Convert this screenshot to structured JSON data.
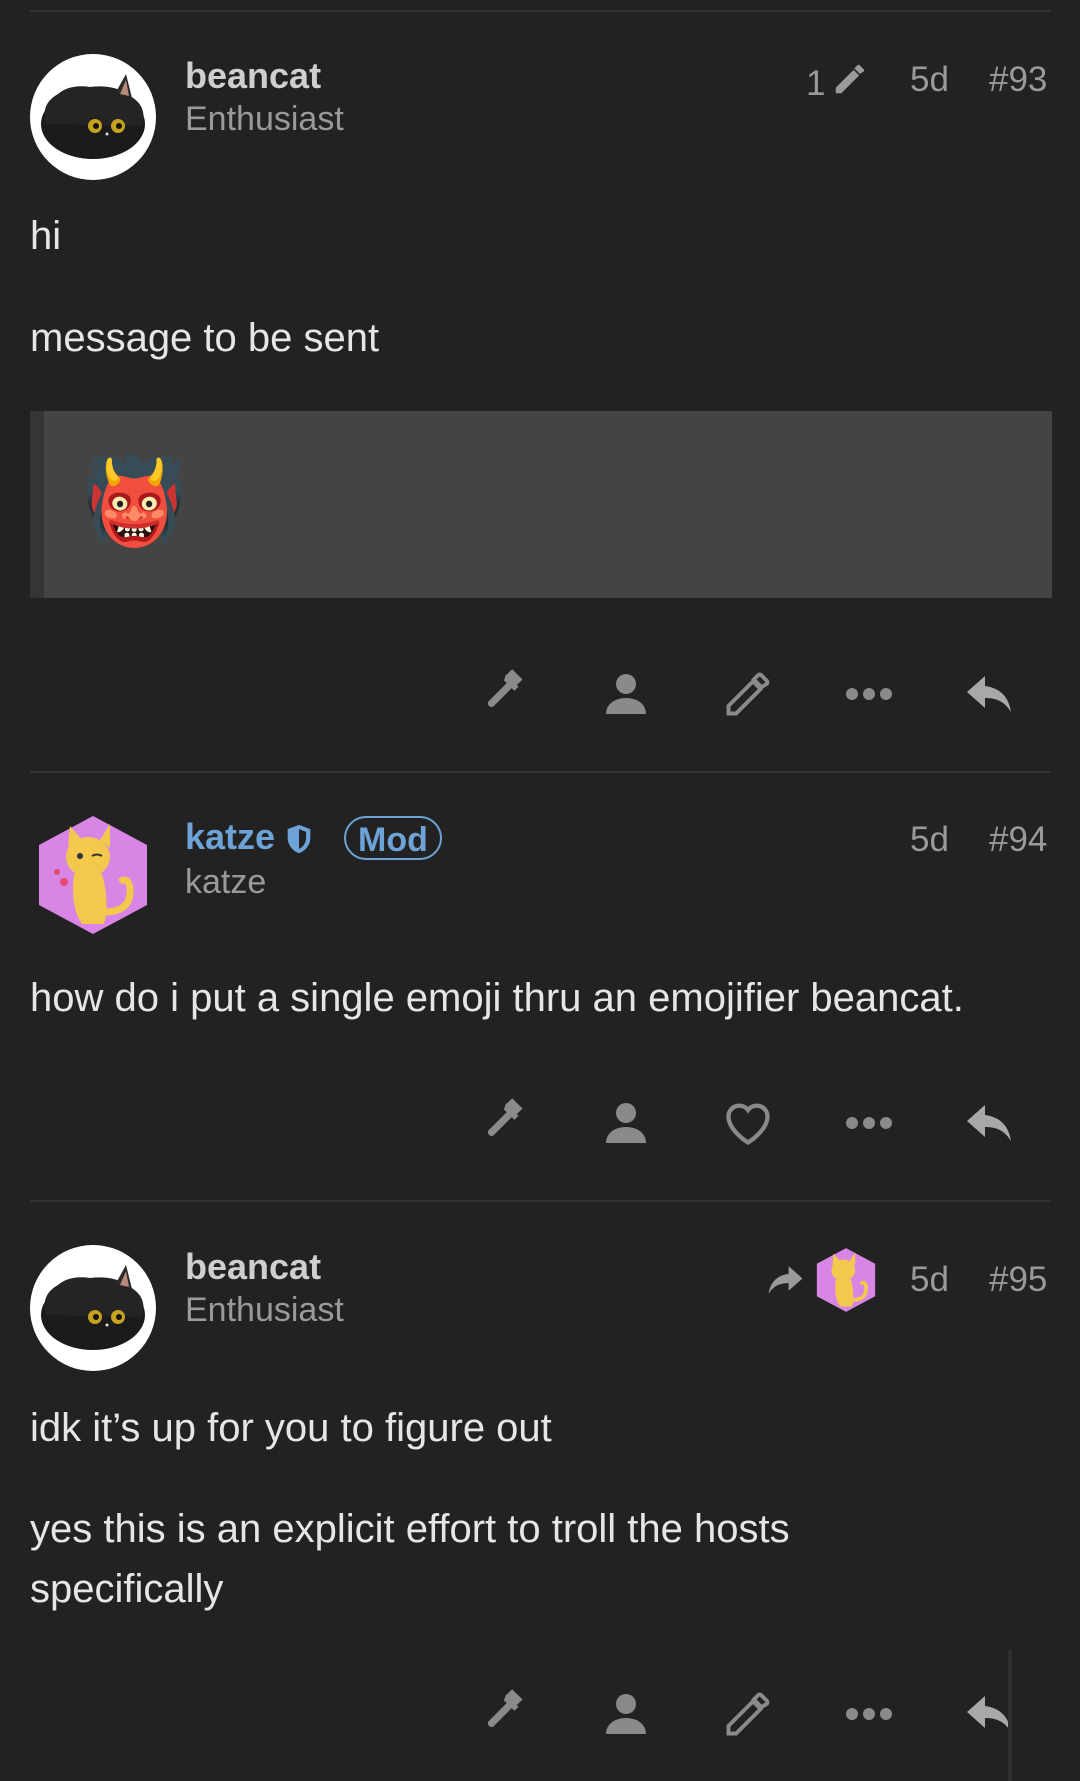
{
  "posts": [
    {
      "username": "beancat",
      "user_title": "Enthusiast",
      "edit_count": "1",
      "age": "5d",
      "number": "#93",
      "paragraphs": [
        "hi",
        "message to be sent"
      ],
      "quote_emoji": "👹",
      "avatar_icon": "black-cat-avatar",
      "actions": [
        "hammer-icon",
        "user-icon",
        "pencil-icon",
        "ellipsis-icon",
        "reply-icon"
      ]
    },
    {
      "username": "katze",
      "user_title": "katze",
      "badge": "Mod",
      "age": "5d",
      "number": "#94",
      "paragraphs": [
        "how do i put a single emoji thru an emojifier beancat."
      ],
      "avatar_icon": "yellow-cat-hexagon-avatar",
      "actions": [
        "hammer-icon",
        "user-icon",
        "heart-icon",
        "ellipsis-icon",
        "reply-icon"
      ]
    },
    {
      "username": "beancat",
      "user_title": "Enthusiast",
      "age": "5d",
      "number": "#95",
      "paragraphs": [
        "idk it’s up for you to figure out",
        "yes this is an explicit effort to troll the hosts specifically"
      ],
      "avatar_icon": "black-cat-avatar",
      "actions": [
        "hammer-icon",
        "user-icon",
        "pencil-icon",
        "ellipsis-icon",
        "reply-icon"
      ]
    }
  ],
  "colors": {
    "background": "#222222",
    "text": "#e6e6e6",
    "muted": "#9a9a9a",
    "mod_accent": "#6ea3d8"
  }
}
